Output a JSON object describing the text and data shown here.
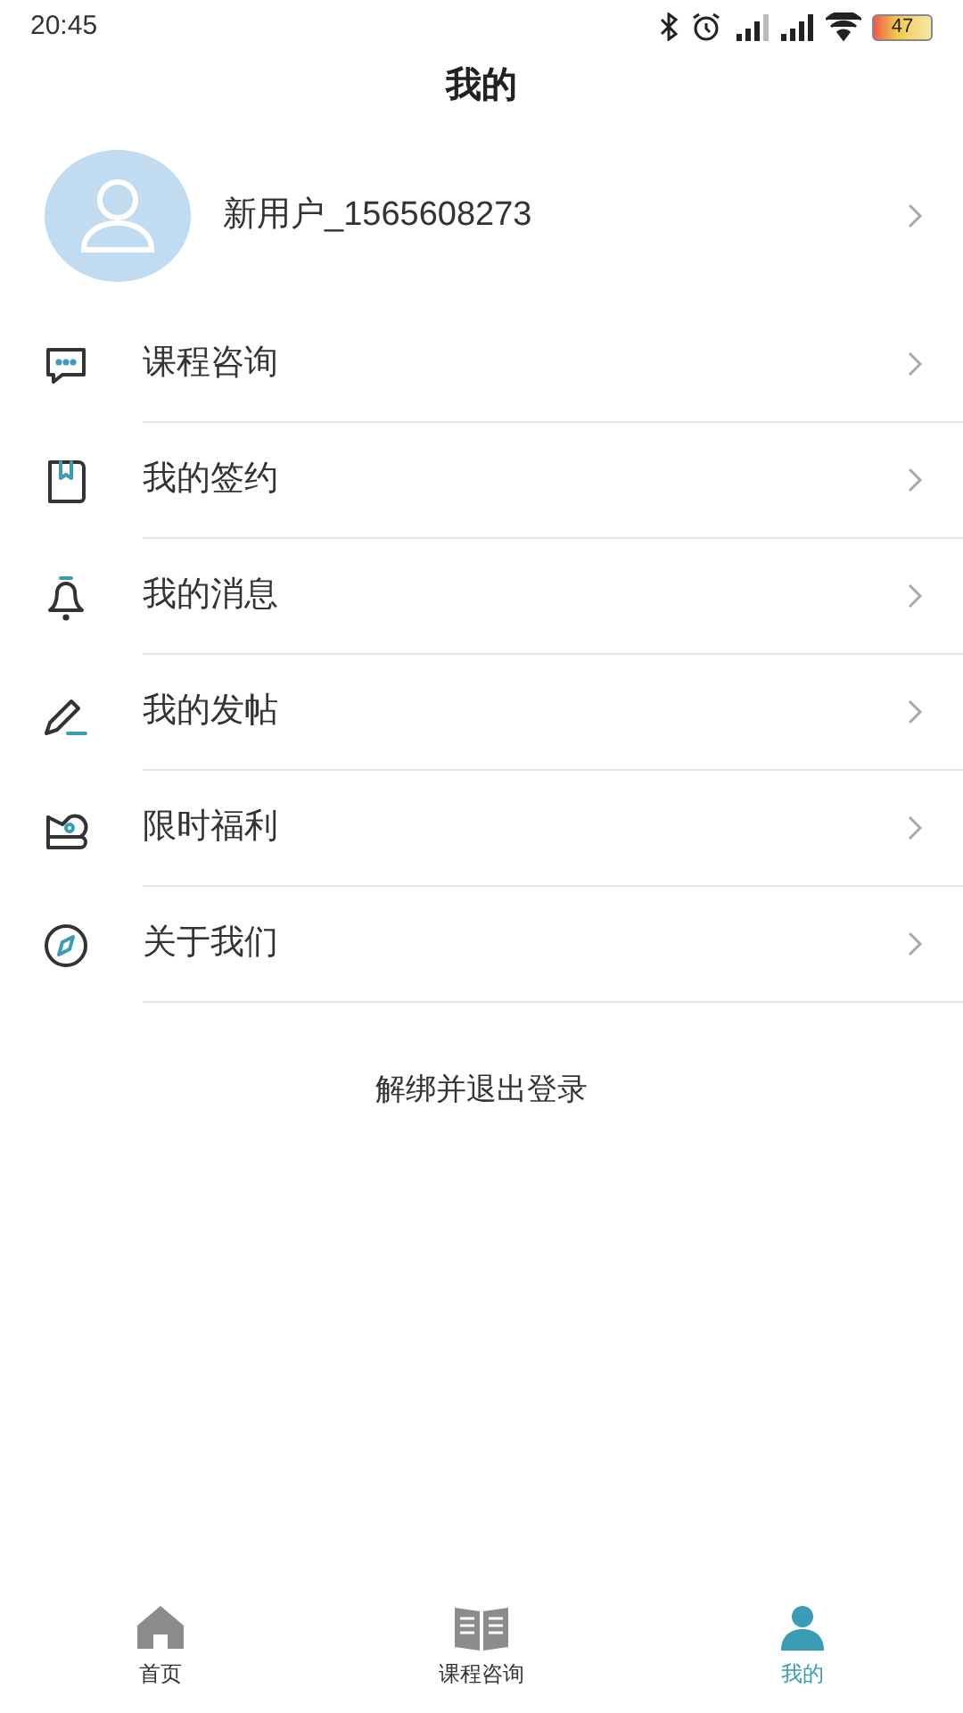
{
  "status_bar": {
    "time": "20:45",
    "battery": "47"
  },
  "title": "我的",
  "profile": {
    "username": "新用户_1565608273"
  },
  "menu": [
    {
      "kind": "chat",
      "label": "课程咨询"
    },
    {
      "kind": "book",
      "label": "我的签约"
    },
    {
      "kind": "bell",
      "label": "我的消息"
    },
    {
      "kind": "pen",
      "label": "我的发帖"
    },
    {
      "kind": "gift",
      "label": "限时福利"
    },
    {
      "kind": "compass",
      "label": "关于我们"
    }
  ],
  "logout": "解绑并退出登录",
  "tabs": [
    {
      "kind": "home",
      "label": "首页",
      "selected": false
    },
    {
      "kind": "book",
      "label": "课程咨询",
      "selected": false
    },
    {
      "kind": "user",
      "label": "我的",
      "selected": true
    }
  ]
}
